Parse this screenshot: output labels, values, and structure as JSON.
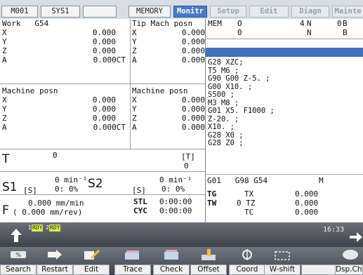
{
  "tabs": [
    {
      "label": "M001"
    },
    {
      "label": "SYS1"
    },
    {
      "label": ""
    },
    {
      "label": "MEMORY"
    },
    {
      "label": "Monitr"
    },
    {
      "label": "Setup"
    },
    {
      "label": "Edit"
    },
    {
      "label": "Diagn"
    },
    {
      "label": "Mainte"
    }
  ],
  "work": {
    "title": "Work   G54",
    "axes": [
      {
        "axis": "X",
        "value": "0.000"
      },
      {
        "axis": "Y",
        "value": "0.000"
      },
      {
        "axis": "Z",
        "value": "0.000"
      },
      {
        "axis": "A",
        "value": "0.000CT"
      }
    ]
  },
  "tip": {
    "title": "Tip Mach posn",
    "axes": [
      {
        "axis": "X",
        "value": "0.000"
      },
      {
        "axis": "Y",
        "value": "0.000"
      },
      {
        "axis": "Z",
        "value": "0.000"
      },
      {
        "axis": "A",
        "value": "0.000"
      }
    ]
  },
  "machine": {
    "title": "Machine posn",
    "axes": [
      {
        "axis": "X",
        "value": "0.000"
      },
      {
        "axis": "Y",
        "value": "0.000"
      },
      {
        "axis": "Z",
        "value": "0.000"
      },
      {
        "axis": "A",
        "value": "0.000CT"
      }
    ]
  },
  "machine2": {
    "title": "Machine posn",
    "axes": [
      {
        "axis": "X",
        "value": "0.000"
      },
      {
        "axis": "Y",
        "value": "0.000"
      },
      {
        "axis": "Z",
        "value": "0.000"
      },
      {
        "axis": "A",
        "value": "0.000"
      }
    ]
  },
  "program": {
    "mem": "MEM",
    "o_label": "O",
    "n_label": "N",
    "b_label": "B",
    "o_value": "0",
    "n_value": "4",
    "b_value": "0",
    "row2_o": "0",
    "row2_n": "N",
    "row2_b": "B",
    "lines": [
      "G28 XZC;",
      "T5 M6 ;",
      "G90 G00 Z-5. ;",
      "G00 X10. ;",
      "S500 ;",
      "M3 M8 ;",
      "G01 X5. F1000 ;",
      "Z-20. ;",
      "X10. ;",
      "G28 X0 ;",
      "G28 Z0 ;"
    ]
  },
  "tool": {
    "label": "T",
    "value": "0",
    "bracket": "[T]",
    "bracket_value": "0"
  },
  "spindle": {
    "s1_label": "S1",
    "s1_bracket": "[S]",
    "s1_speed": "0 min⁻¹",
    "s1_pct": "0:  0%",
    "s2_label": "S2",
    "s2_bracket": "[S]",
    "s2_speed": "0 min⁻¹",
    "s2_pct": "0:  0%"
  },
  "feed": {
    "label": "F",
    "rate": "0.000 mm/min",
    "rev": "( 0.000  mm/rev)"
  },
  "cycle": {
    "stl_label": "STL",
    "stl_value": "0:00:00",
    "cyc_label": "CYC",
    "cyc_value": "0:00:00"
  },
  "modal": {
    "codes": "G01   G98 G54",
    "m_label": "M",
    "tg": "TG",
    "tw": "TW",
    "tx_label": "TX",
    "tx_value": "0.000",
    "tz_label": "0 TZ",
    "tz_value": "0.000",
    "tc_label": "TC",
    "tc_value": "0.000"
  },
  "status": {
    "badge1_num": "1",
    "badge1": "RDY",
    "badge2_num": "2",
    "badge2": "RDY",
    "time": "16:33"
  },
  "softkeys": [
    {
      "label": "Search",
      "icon": "search-icon"
    },
    {
      "label": "Restart",
      "icon": "restart-icon"
    },
    {
      "label": "Edit",
      "icon": "edit-icon"
    },
    {
      "label": "Trace",
      "icon": "trace-icon"
    },
    {
      "label": "Check",
      "icon": "check-icon"
    },
    {
      "label": "Offset",
      "icon": "offset-icon"
    },
    {
      "label": "Coord",
      "icon": "coord-icon"
    },
    {
      "label": "W-shift",
      "icon": "w-shift-icon"
    },
    {
      "label": "",
      "icon": "blank"
    },
    {
      "label": "Dsp.Chg",
      "icon": "display-change-icon"
    }
  ],
  "colors": {
    "active_tab": "#4a79c6",
    "nc_band": "#3f6fc0",
    "rdy": "#d6f04a"
  }
}
